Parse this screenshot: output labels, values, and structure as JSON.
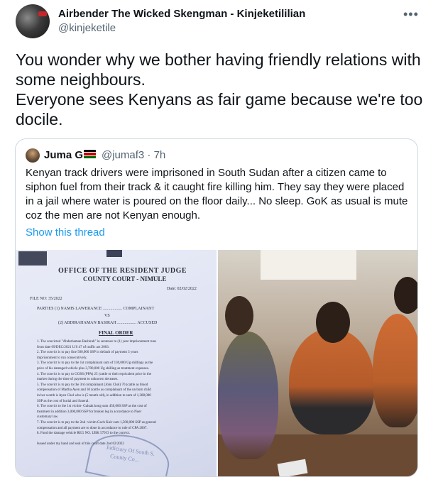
{
  "tweet": {
    "author_name": "Airbender The Wicked Skengman - Kinjeketililian",
    "author_handle": "@kinjeketile",
    "more_icon": "more-horizontal-icon",
    "text_lines": [
      "You wonder why we bother having friendly relations with some neighbours.",
      "Everyone sees Kenyans as fair game because we're too docile."
    ]
  },
  "quoted_tweet": {
    "author_name": "Juma G",
    "flag_icon": "kenya-flag-icon",
    "author_handle": "@jumaf3",
    "time": "· 7h",
    "text": "Kenyan track drivers were imprisoned in South Sudan after a citizen came to siphon fuel from their track & it caught fire killing him. They say they were placed in a jail where water is poured on the floor daily... No sleep. GoK as usual is mute coz the men are not Kenyan enough.",
    "show_thread": "Show this thread"
  },
  "document": {
    "office": "OFFICE OF THE RESIDENT JUDGE",
    "court": "COUNTY COURT - NIMULE",
    "date": "Date: 02/02/2022",
    "file_no": "FILE NO: 35/2022",
    "party1": "PARTIES (1) NAMIS LAWERANCE .................. COMPLAINANT",
    "vs": "VS",
    "party2": "(2) ABDIRAHAMAN BASIRAH .................. ACCUSED",
    "final_order": "FINAL ORDER",
    "lines": [
      "1. The convicted \"Abdarhaman Bashirah\" in sentence to (1) year imprisonment runs",
      "   from date 09/DEC/2021 U/S 47 of traffic act 2003.",
      "2. The convict is to pay fine 500,000 SSP in default of payment 3 years",
      "   imprisonment to run consecutively.",
      "3. The convict is to pay to the 1st complainant sum of 130,000 Ug shillings as the",
      "   price of his damaged vehicle plus 3,700,000 Ug shilling as treatment expenses.",
      "4. The convict is to pay to GOSS (PPA) 25 (cattle or their equivalent price in the",
      "   market during the time of payment to unknown deceases.",
      "5. The convict is to pay to the 3rd complainant (John Chol) 70 (cattle as blood",
      "   compensation of Martha Ayen and 30 (cattle as complainant of the un born child",
      "   in her womb is Ayen Chol who is (5 month old), in addition to sum of 1,388,000",
      "   SSP as the cost of burial and funeral.",
      "6. The convict to the 1st victim- Galuak kong sum 450,000 SSP as the cost of",
      "   treatment in addition 3,000,000 SSP for broken leg in accordance to Nuer",
      "   customary law.",
      "7. The convict is to pay to the 2nd -victim Goch Kuir sum 1,500,000 SSP as general",
      "   compensation and all payment are to done in accordance to rule of CPA 2007.",
      "8. Fund the damage vehicle REG NO. UBK 579 D to the convict.",
      "",
      "Issued under my hand and seal of this court date 2nd 02/2022"
    ],
    "stamp_text": "Judiciary Of South S.",
    "stamp_sub": "County Co..."
  }
}
